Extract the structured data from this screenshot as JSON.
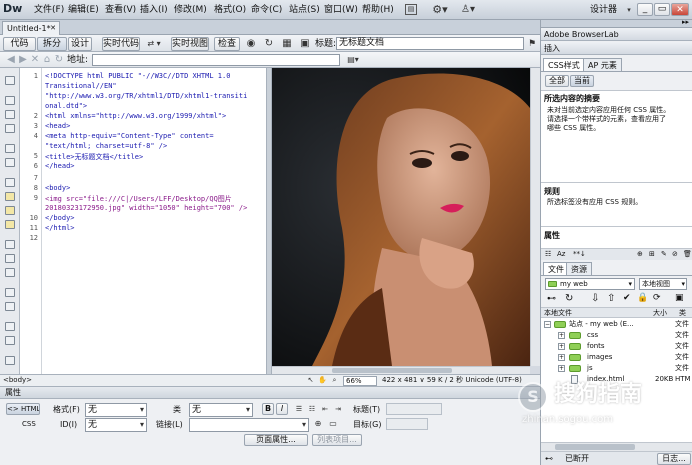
{
  "app": {
    "logo": "Dw",
    "menu": [
      "文件(F)",
      "编辑(E)",
      "查看(V)",
      "插入(I)",
      "修改(M)",
      "格式(O)",
      "命令(C)",
      "站点(S)",
      "窗口(W)",
      "帮助(H)"
    ],
    "workspace": "设计器"
  },
  "document": {
    "tab": "Untitled-1*",
    "view_buttons": [
      "代码",
      "拆分",
      "设计",
      "实时代码",
      "实时视图",
      "检查"
    ],
    "title_label": "标题:",
    "title_value": "无标题文档",
    "address_label": "地址:"
  },
  "code": {
    "lines": [
      {
        "n": "1",
        "t": "<!DOCTYPE html PUBLIC \"-//W3C//DTD XHTML 1.0"
      },
      {
        "n": "",
        "t": "Transitional//EN\""
      },
      {
        "n": "",
        "t": "\"http://www.w3.org/TR/xhtml1/DTD/xhtml1-transiti"
      },
      {
        "n": "",
        "t": "onal.dtd\">"
      },
      {
        "n": "2",
        "t": "<html xmlns=\"http://www.w3.org/1999/xhtml\">"
      },
      {
        "n": "3",
        "t": "<head>"
      },
      {
        "n": "4",
        "t": "<meta http-equiv=\"Content-Type\" content="
      },
      {
        "n": "",
        "t": "\"text/html; charset=utf-8\" />"
      },
      {
        "n": "5",
        "t": "<title>无标题文档</title>"
      },
      {
        "n": "6",
        "t": "</head>"
      },
      {
        "n": "7",
        "t": ""
      },
      {
        "n": "8",
        "t": "<body>"
      },
      {
        "n": "9",
        "t": "<img src=\"file:///C|/Users/LFF/Desktop/QQ图片"
      },
      {
        "n": "",
        "t": "20180323172950.jpg\" width=\"1050\" height=\"700\" />"
      },
      {
        "n": "10",
        "t": "</body>"
      },
      {
        "n": "11",
        "t": "</html>"
      },
      {
        "n": "12",
        "t": ""
      }
    ]
  },
  "status": {
    "tag": "<body>",
    "zoom": "66%",
    "size": "422 x 481 ∨ 59 K / 2 秒 Unicode (UTF-8)"
  },
  "properties": {
    "title": "属性",
    "html_btn": "<> HTML",
    "css_btn": "CSS",
    "format_label": "格式(F)",
    "format_value": "无",
    "class_label": "类",
    "class_value": "无",
    "id_label": "ID(I)",
    "id_value": "无",
    "link_label": "链接(L)",
    "bold": "B",
    "italic": "I",
    "heading_label": "标题(T)",
    "target_label": "目标(G)",
    "page_props": "页面属性...",
    "list_item": "列表项目..."
  },
  "right": {
    "browserlab": "Adobe BrowserLab",
    "insert": "插入",
    "css_tab": "CSS样式",
    "ap_tab": "AP 元素",
    "all_btn": "全部",
    "current_btn": "当前",
    "summary_title": "所选内容的摘要",
    "summary_text_1": "未对当前选定内容应用任何 CSS 属性。",
    "summary_text_2": "请选择一个带样式的元素，查看应用了",
    "summary_text_3": "哪些 CSS 属性。",
    "rules_title": "规则",
    "rules_text": "所选标签没有应用 CSS 规则。",
    "props_title": "属性",
    "files_tab": "文件",
    "assets_tab": "资源",
    "site_select": "my web",
    "view_select": "本地视图",
    "col_local": "本地文件",
    "col_size": "大小",
    "col_type": "类",
    "site_root": "站点 - my web (E...",
    "tree": [
      {
        "name": "css",
        "type": "文件"
      },
      {
        "name": "fonts",
        "type": "文件"
      },
      {
        "name": "images",
        "type": "文件"
      },
      {
        "name": "js",
        "type": "文件"
      },
      {
        "name": "index.html",
        "size": "20KB",
        "type": "HTM"
      }
    ],
    "root_type": "文件",
    "connected": "已断开",
    "log_btn": "日志..."
  },
  "watermark": {
    "line1": "搜狗指南",
    "line2": "zhinan.sogou.com"
  }
}
